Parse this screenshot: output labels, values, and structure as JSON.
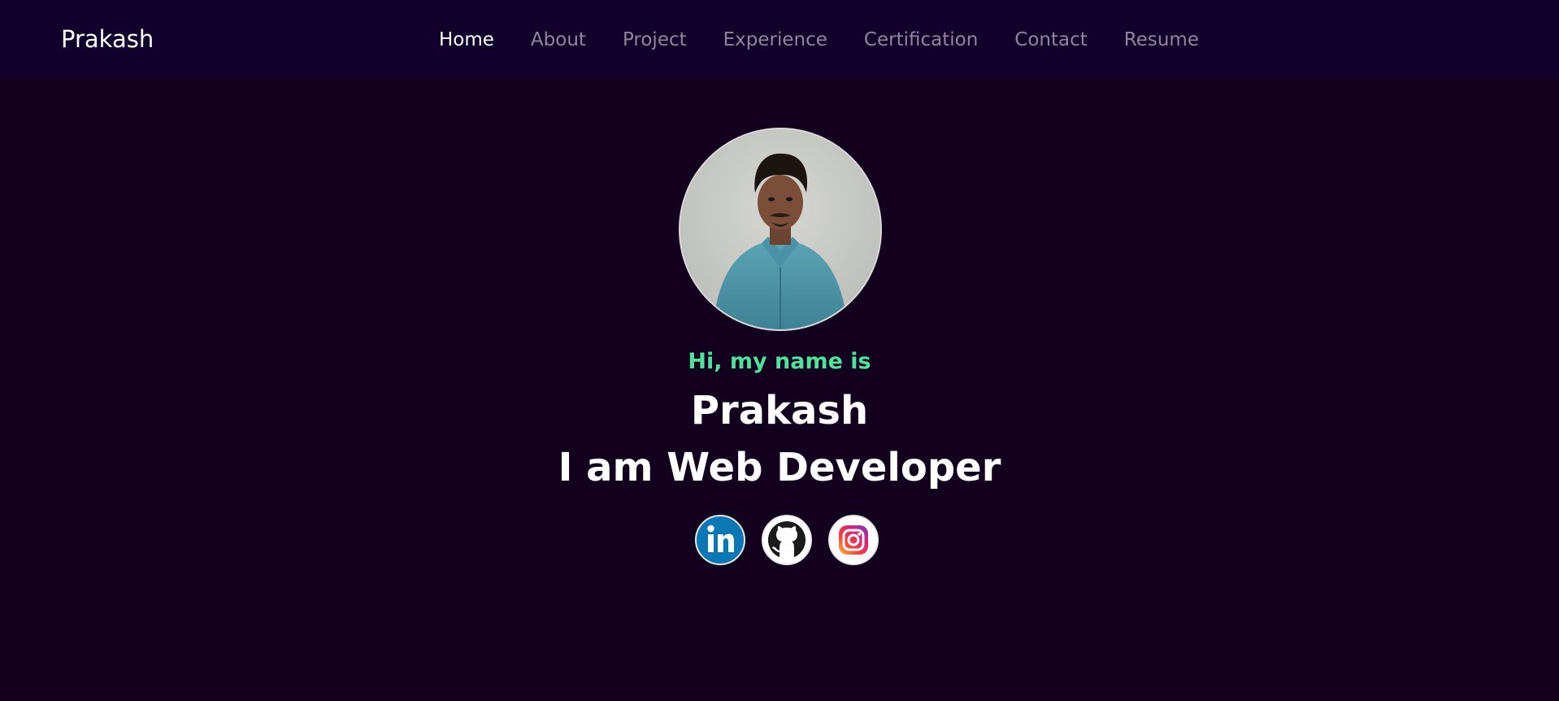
{
  "brand": "Prakash",
  "nav": {
    "items": [
      {
        "label": "Home",
        "active": true
      },
      {
        "label": "About",
        "active": false
      },
      {
        "label": "Project",
        "active": false
      },
      {
        "label": "Experience",
        "active": false
      },
      {
        "label": "Certification",
        "active": false
      },
      {
        "label": "Contact",
        "active": false
      },
      {
        "label": "Resume",
        "active": false
      }
    ]
  },
  "hero": {
    "greeting": "Hi, my name is",
    "name": "Prakash",
    "role": "I am Web Developer"
  },
  "socials": [
    {
      "name": "linkedin-icon",
      "label": "in"
    },
    {
      "name": "github-icon"
    },
    {
      "name": "instagram-icon"
    }
  ],
  "colors": {
    "background": "#13001f",
    "navbar": "#12002c",
    "accent_green": "#4ee39b",
    "nav_inactive": "#8f8699",
    "linkedin": "#0a78b5"
  }
}
